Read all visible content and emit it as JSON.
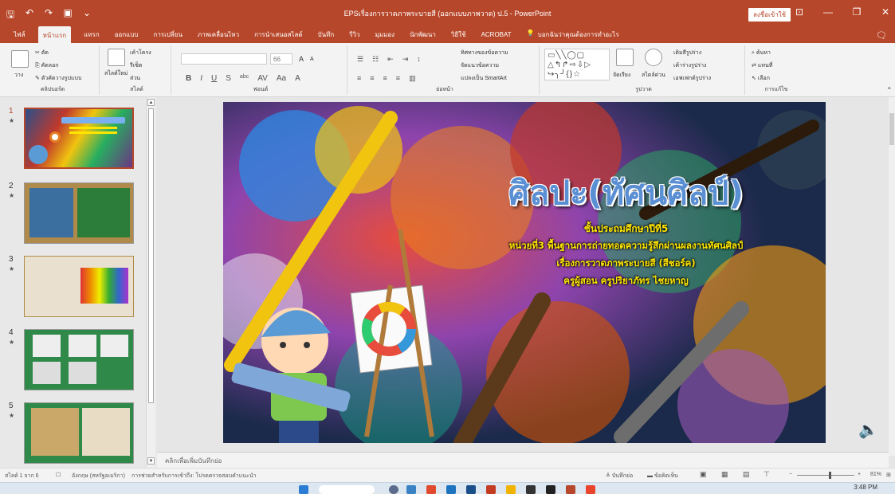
{
  "window": {
    "title": "EPSเรื่องการวาดภาพระบายสี (ออกแบบภาพวาด) ป.5  -  PowerPoint",
    "signin_label": "ลงชื่อเข้าใช้"
  },
  "qat": {
    "save": "🖫",
    "undo": "↶",
    "redo": "↷",
    "present": "▣",
    "customize": "⌄"
  },
  "tabs": [
    {
      "label": "ไฟล์"
    },
    {
      "label": "หน้าแรก"
    },
    {
      "label": "แทรก"
    },
    {
      "label": "ออกแบบ"
    },
    {
      "label": "การเปลี่ยน"
    },
    {
      "label": "ภาพเคลื่อนไหว"
    },
    {
      "label": "การนำเสนอสไลด์"
    },
    {
      "label": "บันทึก"
    },
    {
      "label": "รีวิว"
    },
    {
      "label": "มุมมอง"
    },
    {
      "label": "นักพัฒนา"
    },
    {
      "label": "วิธีใช้"
    },
    {
      "label": "ACROBAT"
    }
  ],
  "tellme": {
    "icon": "lightbulb-icon",
    "text": "บอกฉันว่าคุณต้องการทำอะไร"
  },
  "ribbon": {
    "clipboard": {
      "label": "คลิปบอร์ด",
      "paste": "วาง",
      "cut": "ตัด",
      "copy": "คัดลอก",
      "format_painter": "ตัวคัดวางรูปแบบ"
    },
    "slides": {
      "label": "สไลด์",
      "new_slide": "สไลด์ใหม่",
      "layout": "เค้าโครง",
      "reset": "รีเซ็ต",
      "section": "ส่วน"
    },
    "font": {
      "label": "ฟอนต์",
      "size": "66",
      "bold": "B",
      "italic": "I",
      "underline": "U",
      "shadow": "S",
      "strike": "abc",
      "spacing": "AV",
      "case": "Aa",
      "grow": "A",
      "shrink": "A",
      "clear": "A"
    },
    "paragraph": {
      "label": "ย่อหน้า",
      "text_direction": "ทิศทางของข้อความ",
      "align_text": "จัดแนวข้อความ",
      "smartart": "แปลงเป็น SmartArt"
    },
    "drawing": {
      "label": "รูปวาด",
      "arrange": "จัดเรียง",
      "quick_styles": "สไตล์ด่วน",
      "shape_fill": "เติมสีรูปร่าง",
      "shape_outline": "เค้าร่างรูปร่าง",
      "shape_effects": "เอฟเฟกต์รูปร่าง"
    },
    "editing": {
      "label": "การแก้ไข",
      "find": "ค้นหา",
      "replace": "แทนที่",
      "select": "เลือก"
    }
  },
  "thumbnails": [
    {
      "number": "1",
      "star": "★",
      "bg": "#8a5a2a"
    },
    {
      "number": "2",
      "star": "★",
      "bg": "#2d7d3a"
    },
    {
      "number": "3",
      "star": "★",
      "bg": "#e9e0d0"
    },
    {
      "number": "4",
      "star": "★",
      "bg": "#2f8a4a"
    },
    {
      "number": "5",
      "star": "★",
      "bg": "#2f8a4a"
    }
  ],
  "slide": {
    "title": "ศิลปะ(ทัศนศิลป์)",
    "lines": [
      "ชั้นประถมศึกษาปีที่5",
      "หน่วยที่3 พื้นฐานการถ่ายทอดความรู้สึกผ่านผลงานทัศนศิลป์",
      "เรื่องการวาดภาพระบายสี (สีชอร์ค)",
      "ครูผู้สอน ครูปริยาภัทร ไชยหาญ"
    ]
  },
  "notes_placeholder": "คลิกเพื่อเพิ่มบันทึกย่อ",
  "status": {
    "slide_count": "สไลด์ 1 จาก 6",
    "language": "อังกฤษ (สหรัฐอเมริกา)",
    "accessibility": "การช่วยสำหรับการเข้าถึง: โปรดตรวจสอบคำแนะนำ",
    "notes_btn": "บันทึกย่อ",
    "comments_btn": "ข้อคิดเห็น",
    "zoom": "81%"
  },
  "taskbar": {
    "time": "3:48 PM"
  }
}
